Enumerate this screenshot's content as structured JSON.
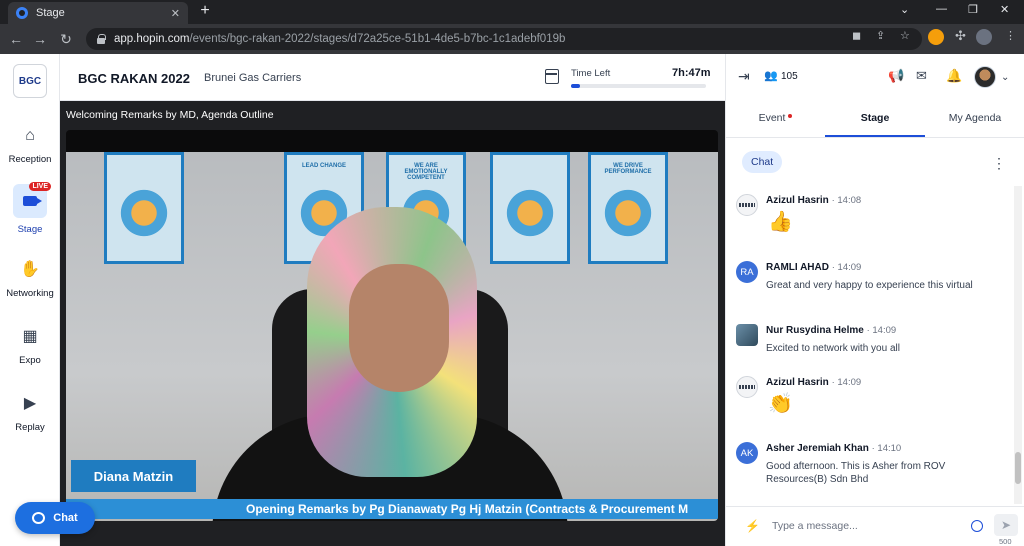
{
  "browser": {
    "tab_title": "Stage",
    "new_tab": "+",
    "url_host": "app.hopin.com",
    "url_path": "/events/bgc-rakan-2022/stages/d72a25ce-51b1-4de5-b7bc-1c1adebf019b"
  },
  "sidebar": {
    "logo": "BGC",
    "items": [
      {
        "label": "Reception",
        "icon": "home-icon"
      },
      {
        "label": "Stage",
        "icon": "camera-icon",
        "badge": "LIVE"
      },
      {
        "label": "Networking",
        "icon": "handshake-icon"
      },
      {
        "label": "Expo",
        "icon": "store-icon"
      },
      {
        "label": "Replay",
        "icon": "play-icon"
      }
    ]
  },
  "header": {
    "event_title": "BGC RAKAN 2022",
    "organizer": "Brunei Gas Carriers",
    "time_left_label": "Time Left",
    "time_left_value": "7h:47m",
    "time_progress": 0.07
  },
  "stage": {
    "title": "Welcoming Remarks by MD, Agenda Outline",
    "speaker_name": "Diana Matzin",
    "ticker": "Opening Remarks by Pg Dianawaty Pg Hj Matzin (Contracts & Procurement M",
    "posters": [
      "",
      "LEAD CHANGE",
      "WE ARE EMOTIONALLY COMPETENT",
      "",
      "WE DRIVE PERFORMANCE"
    ]
  },
  "chat_button": "Chat",
  "panel": {
    "attendee_count": "105",
    "tabs": [
      "Event",
      "Stage",
      "My Agenda"
    ],
    "active_tab": "Stage",
    "chat_pill": "Chat",
    "messages": [
      {
        "name": "Azizul Hasrin",
        "time": "· 14:08",
        "text": "",
        "emoji": "👍",
        "avatar": ""
      },
      {
        "name": "RAMLI AHAD",
        "time": "· 14:09",
        "text": "Great and very happy to experience this virtual",
        "avatar": "RA"
      },
      {
        "name": "Nur Rusydina Helme",
        "time": "· 14:09",
        "text": "Excited to network with you all",
        "avatar": ""
      },
      {
        "name": "Azizul Hasrin",
        "time": "· 14:09",
        "text": "",
        "emoji": "👏",
        "avatar": ""
      },
      {
        "name": "Asher Jeremiah Khan",
        "time": "· 14:10",
        "text": "Good afternoon. This is Asher from ROV Resources(B) Sdn Bhd",
        "avatar": "AK"
      }
    ],
    "input_placeholder": "Type a message...",
    "char_limit": "500"
  },
  "colors": {
    "accent": "#1d4ed8",
    "live": "#dc2626",
    "ticker": "#2c8fd6"
  }
}
